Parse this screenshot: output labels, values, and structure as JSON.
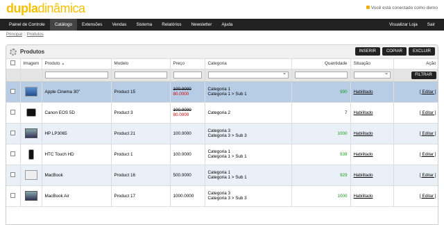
{
  "header": {
    "logo_bold": "dupla",
    "logo_light": "dinâmica",
    "logged": "Você está conectado como demo"
  },
  "menu": {
    "items": [
      "Painel de Controle",
      "Catálogo",
      "Extensões",
      "Vendas",
      "Sistema",
      "Relatórios",
      "Newsletter",
      "Ajuda"
    ],
    "active": 1,
    "right": [
      "Visualizar Loja",
      "Sair"
    ]
  },
  "breadcrumb": {
    "home": "Principal",
    "sep": "::",
    "current": "Produtos"
  },
  "box": {
    "title": "Produtos",
    "buttons": [
      "INSERIR",
      "COPIAR",
      "EXCLUIR"
    ]
  },
  "table": {
    "headers": [
      "Imagem",
      "Produto",
      "Modelo",
      "Preço",
      "Categoria",
      "Quantidade",
      "Situação",
      "Ação"
    ],
    "filter_button": "FILTRAR",
    "rows": [
      {
        "thumb": "monitor",
        "product": "Apple Cinema 30\"",
        "model": "Product 15",
        "price": "100.0000",
        "special": "80.0000",
        "cat1": "Categoria 1",
        "cat2": "Categoria 1 > Sub 1",
        "qty": "990",
        "status": "Habilitado",
        "action": "[ Editar ]",
        "selected": true
      },
      {
        "thumb": "camera",
        "product": "Canon EOS 5D",
        "model": "Product 3",
        "price": "100.0000",
        "special": "80.0000",
        "cat1": "Categoria 2",
        "cat2": "",
        "qty": "7",
        "status": "Habilitado",
        "action": "[ Editar ]"
      },
      {
        "thumb": "laptop",
        "product": "HP LP3065",
        "model": "Product 21",
        "price": "100.0000",
        "special": "",
        "cat1": "Categoria 3",
        "cat2": "Categoria 3 > Sub 3",
        "qty": "1000",
        "status": "Habilitado",
        "action": "[ Editar ]"
      },
      {
        "thumb": "phone",
        "product": "HTC Touch HD",
        "model": "Product 1",
        "price": "100.0000",
        "special": "",
        "cat1": "Categoria 1",
        "cat2": "Categoria 1 > Sub 1",
        "qty": "939",
        "status": "Habilitado",
        "action": "[ Editar ]"
      },
      {
        "thumb": "macbook",
        "product": "MacBook",
        "model": "Product 16",
        "price": "500.0000",
        "special": "",
        "cat1": "Categoria 1",
        "cat2": "Categoria 1 > Sub 1",
        "qty": "929",
        "status": "Habilitado",
        "action": "[ Editar ]"
      },
      {
        "thumb": "macbook",
        "product": "MacBook Air",
        "model": "Product 17",
        "price": "1000.0000",
        "special": "",
        "cat1": "Categoria 3",
        "cat2": "Categoria 3 > Sub 3",
        "qty": "1000",
        "status": "Habilitado",
        "action": "[ Editar ]"
      }
    ]
  }
}
